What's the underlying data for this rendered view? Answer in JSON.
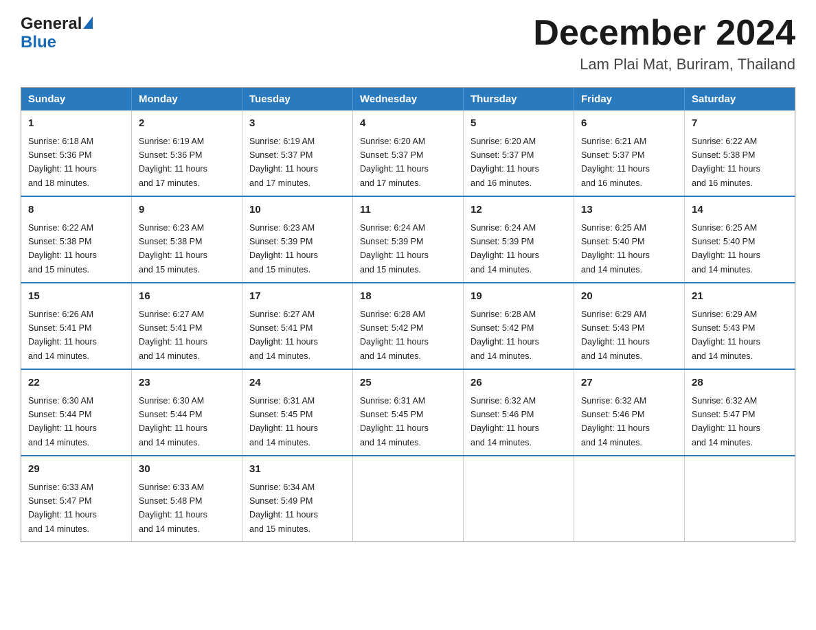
{
  "logo": {
    "general": "General",
    "blue": "Blue"
  },
  "title": "December 2024",
  "location": "Lam Plai Mat, Buriram, Thailand",
  "days_of_week": [
    "Sunday",
    "Monday",
    "Tuesday",
    "Wednesday",
    "Thursday",
    "Friday",
    "Saturday"
  ],
  "weeks": [
    [
      {
        "day": "1",
        "sunrise": "6:18 AM",
        "sunset": "5:36 PM",
        "daylight": "11 hours and 18 minutes."
      },
      {
        "day": "2",
        "sunrise": "6:19 AM",
        "sunset": "5:36 PM",
        "daylight": "11 hours and 17 minutes."
      },
      {
        "day": "3",
        "sunrise": "6:19 AM",
        "sunset": "5:37 PM",
        "daylight": "11 hours and 17 minutes."
      },
      {
        "day": "4",
        "sunrise": "6:20 AM",
        "sunset": "5:37 PM",
        "daylight": "11 hours and 17 minutes."
      },
      {
        "day": "5",
        "sunrise": "6:20 AM",
        "sunset": "5:37 PM",
        "daylight": "11 hours and 16 minutes."
      },
      {
        "day": "6",
        "sunrise": "6:21 AM",
        "sunset": "5:37 PM",
        "daylight": "11 hours and 16 minutes."
      },
      {
        "day": "7",
        "sunrise": "6:22 AM",
        "sunset": "5:38 PM",
        "daylight": "11 hours and 16 minutes."
      }
    ],
    [
      {
        "day": "8",
        "sunrise": "6:22 AM",
        "sunset": "5:38 PM",
        "daylight": "11 hours and 15 minutes."
      },
      {
        "day": "9",
        "sunrise": "6:23 AM",
        "sunset": "5:38 PM",
        "daylight": "11 hours and 15 minutes."
      },
      {
        "day": "10",
        "sunrise": "6:23 AM",
        "sunset": "5:39 PM",
        "daylight": "11 hours and 15 minutes."
      },
      {
        "day": "11",
        "sunrise": "6:24 AM",
        "sunset": "5:39 PM",
        "daylight": "11 hours and 15 minutes."
      },
      {
        "day": "12",
        "sunrise": "6:24 AM",
        "sunset": "5:39 PM",
        "daylight": "11 hours and 14 minutes."
      },
      {
        "day": "13",
        "sunrise": "6:25 AM",
        "sunset": "5:40 PM",
        "daylight": "11 hours and 14 minutes."
      },
      {
        "day": "14",
        "sunrise": "6:25 AM",
        "sunset": "5:40 PM",
        "daylight": "11 hours and 14 minutes."
      }
    ],
    [
      {
        "day": "15",
        "sunrise": "6:26 AM",
        "sunset": "5:41 PM",
        "daylight": "11 hours and 14 minutes."
      },
      {
        "day": "16",
        "sunrise": "6:27 AM",
        "sunset": "5:41 PM",
        "daylight": "11 hours and 14 minutes."
      },
      {
        "day": "17",
        "sunrise": "6:27 AM",
        "sunset": "5:41 PM",
        "daylight": "11 hours and 14 minutes."
      },
      {
        "day": "18",
        "sunrise": "6:28 AM",
        "sunset": "5:42 PM",
        "daylight": "11 hours and 14 minutes."
      },
      {
        "day": "19",
        "sunrise": "6:28 AM",
        "sunset": "5:42 PM",
        "daylight": "11 hours and 14 minutes."
      },
      {
        "day": "20",
        "sunrise": "6:29 AM",
        "sunset": "5:43 PM",
        "daylight": "11 hours and 14 minutes."
      },
      {
        "day": "21",
        "sunrise": "6:29 AM",
        "sunset": "5:43 PM",
        "daylight": "11 hours and 14 minutes."
      }
    ],
    [
      {
        "day": "22",
        "sunrise": "6:30 AM",
        "sunset": "5:44 PM",
        "daylight": "11 hours and 14 minutes."
      },
      {
        "day": "23",
        "sunrise": "6:30 AM",
        "sunset": "5:44 PM",
        "daylight": "11 hours and 14 minutes."
      },
      {
        "day": "24",
        "sunrise": "6:31 AM",
        "sunset": "5:45 PM",
        "daylight": "11 hours and 14 minutes."
      },
      {
        "day": "25",
        "sunrise": "6:31 AM",
        "sunset": "5:45 PM",
        "daylight": "11 hours and 14 minutes."
      },
      {
        "day": "26",
        "sunrise": "6:32 AM",
        "sunset": "5:46 PM",
        "daylight": "11 hours and 14 minutes."
      },
      {
        "day": "27",
        "sunrise": "6:32 AM",
        "sunset": "5:46 PM",
        "daylight": "11 hours and 14 minutes."
      },
      {
        "day": "28",
        "sunrise": "6:32 AM",
        "sunset": "5:47 PM",
        "daylight": "11 hours and 14 minutes."
      }
    ],
    [
      {
        "day": "29",
        "sunrise": "6:33 AM",
        "sunset": "5:47 PM",
        "daylight": "11 hours and 14 minutes."
      },
      {
        "day": "30",
        "sunrise": "6:33 AM",
        "sunset": "5:48 PM",
        "daylight": "11 hours and 14 minutes."
      },
      {
        "day": "31",
        "sunrise": "6:34 AM",
        "sunset": "5:49 PM",
        "daylight": "11 hours and 15 minutes."
      },
      null,
      null,
      null,
      null
    ]
  ],
  "labels": {
    "sunrise": "Sunrise:",
    "sunset": "Sunset:",
    "daylight": "Daylight:"
  }
}
